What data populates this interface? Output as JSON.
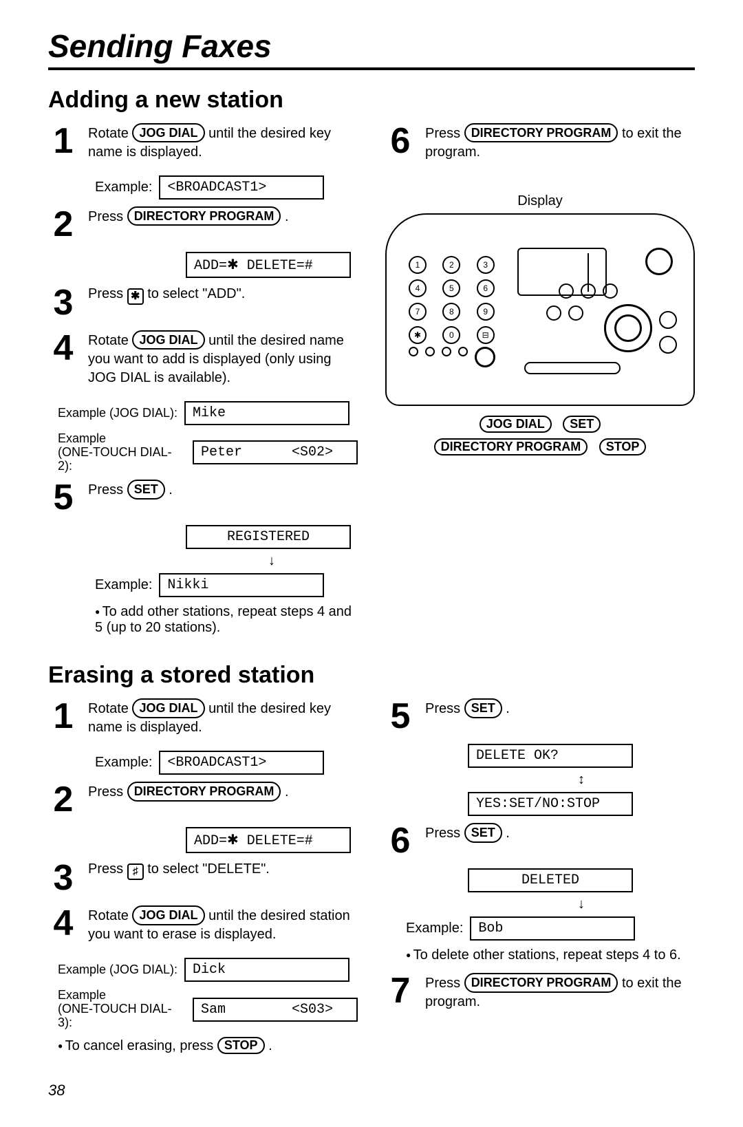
{
  "title": "Sending Faxes",
  "page_number": "38",
  "buttons": {
    "jog_dial": "JOG DIAL",
    "directory_program": "DIRECTORY PROGRAM",
    "set": "SET",
    "stop": "STOP"
  },
  "keys": {
    "star": "✱",
    "hash": "♯"
  },
  "lcd": {
    "broadcast1": "<BROADCAST1>",
    "add_delete": "ADD=✱ DELETE=#",
    "mike": "Mike",
    "peter": "Peter      <S02>",
    "registered": "REGISTERED",
    "nikki": "Nikki",
    "dick": "Dick",
    "sam": "Sam        <S03>",
    "delete_ok": "DELETE OK?",
    "yes_set_no_stop": "YES:SET/NO:STOP",
    "deleted": "DELETED",
    "bob": "Bob"
  },
  "labels": {
    "example": "Example:",
    "example_jog": "Example (JOG DIAL):",
    "example_ot2_a": "Example",
    "example_ot2_b": "(ONE-TOUCH DIAL-2):",
    "example_ot3_a": "Example",
    "example_ot3_b": "(ONE-TOUCH DIAL-3):",
    "display": "Display"
  },
  "adding": {
    "heading": "Adding a new station",
    "s1a": "Rotate ",
    "s1b": " until the desired key name is displayed.",
    "s2a": "Press ",
    "s2b": " .",
    "s3a": "Press ",
    "s3b": " to select \"ADD\".",
    "s4a": "Rotate ",
    "s4b": " until the desired name you want to add is displayed (only using JOG DIAL is available).",
    "s5a": "Press ",
    "s5b": " .",
    "note5": "To add other stations, repeat steps 4 and 5 (up to 20 stations).",
    "s6a": "Press ",
    "s6b": " to exit the program."
  },
  "erasing": {
    "heading": "Erasing a stored station",
    "s1a": "Rotate ",
    "s1b": " until the desired key name is displayed.",
    "s2a": "Press ",
    "s2b": " .",
    "s3a": "Press ",
    "s3b": " to select \"DELETE\".",
    "s4a": "Rotate ",
    "s4b": " until the desired station you want to erase is displayed.",
    "note4": "To cancel erasing, press ",
    "s5a": "Press ",
    "s5b": " .",
    "s6a": "Press ",
    "s6b": " .",
    "note6": "To delete other stations, repeat steps 4 to 6.",
    "s7a": "Press ",
    "s7b": " to exit the program."
  }
}
